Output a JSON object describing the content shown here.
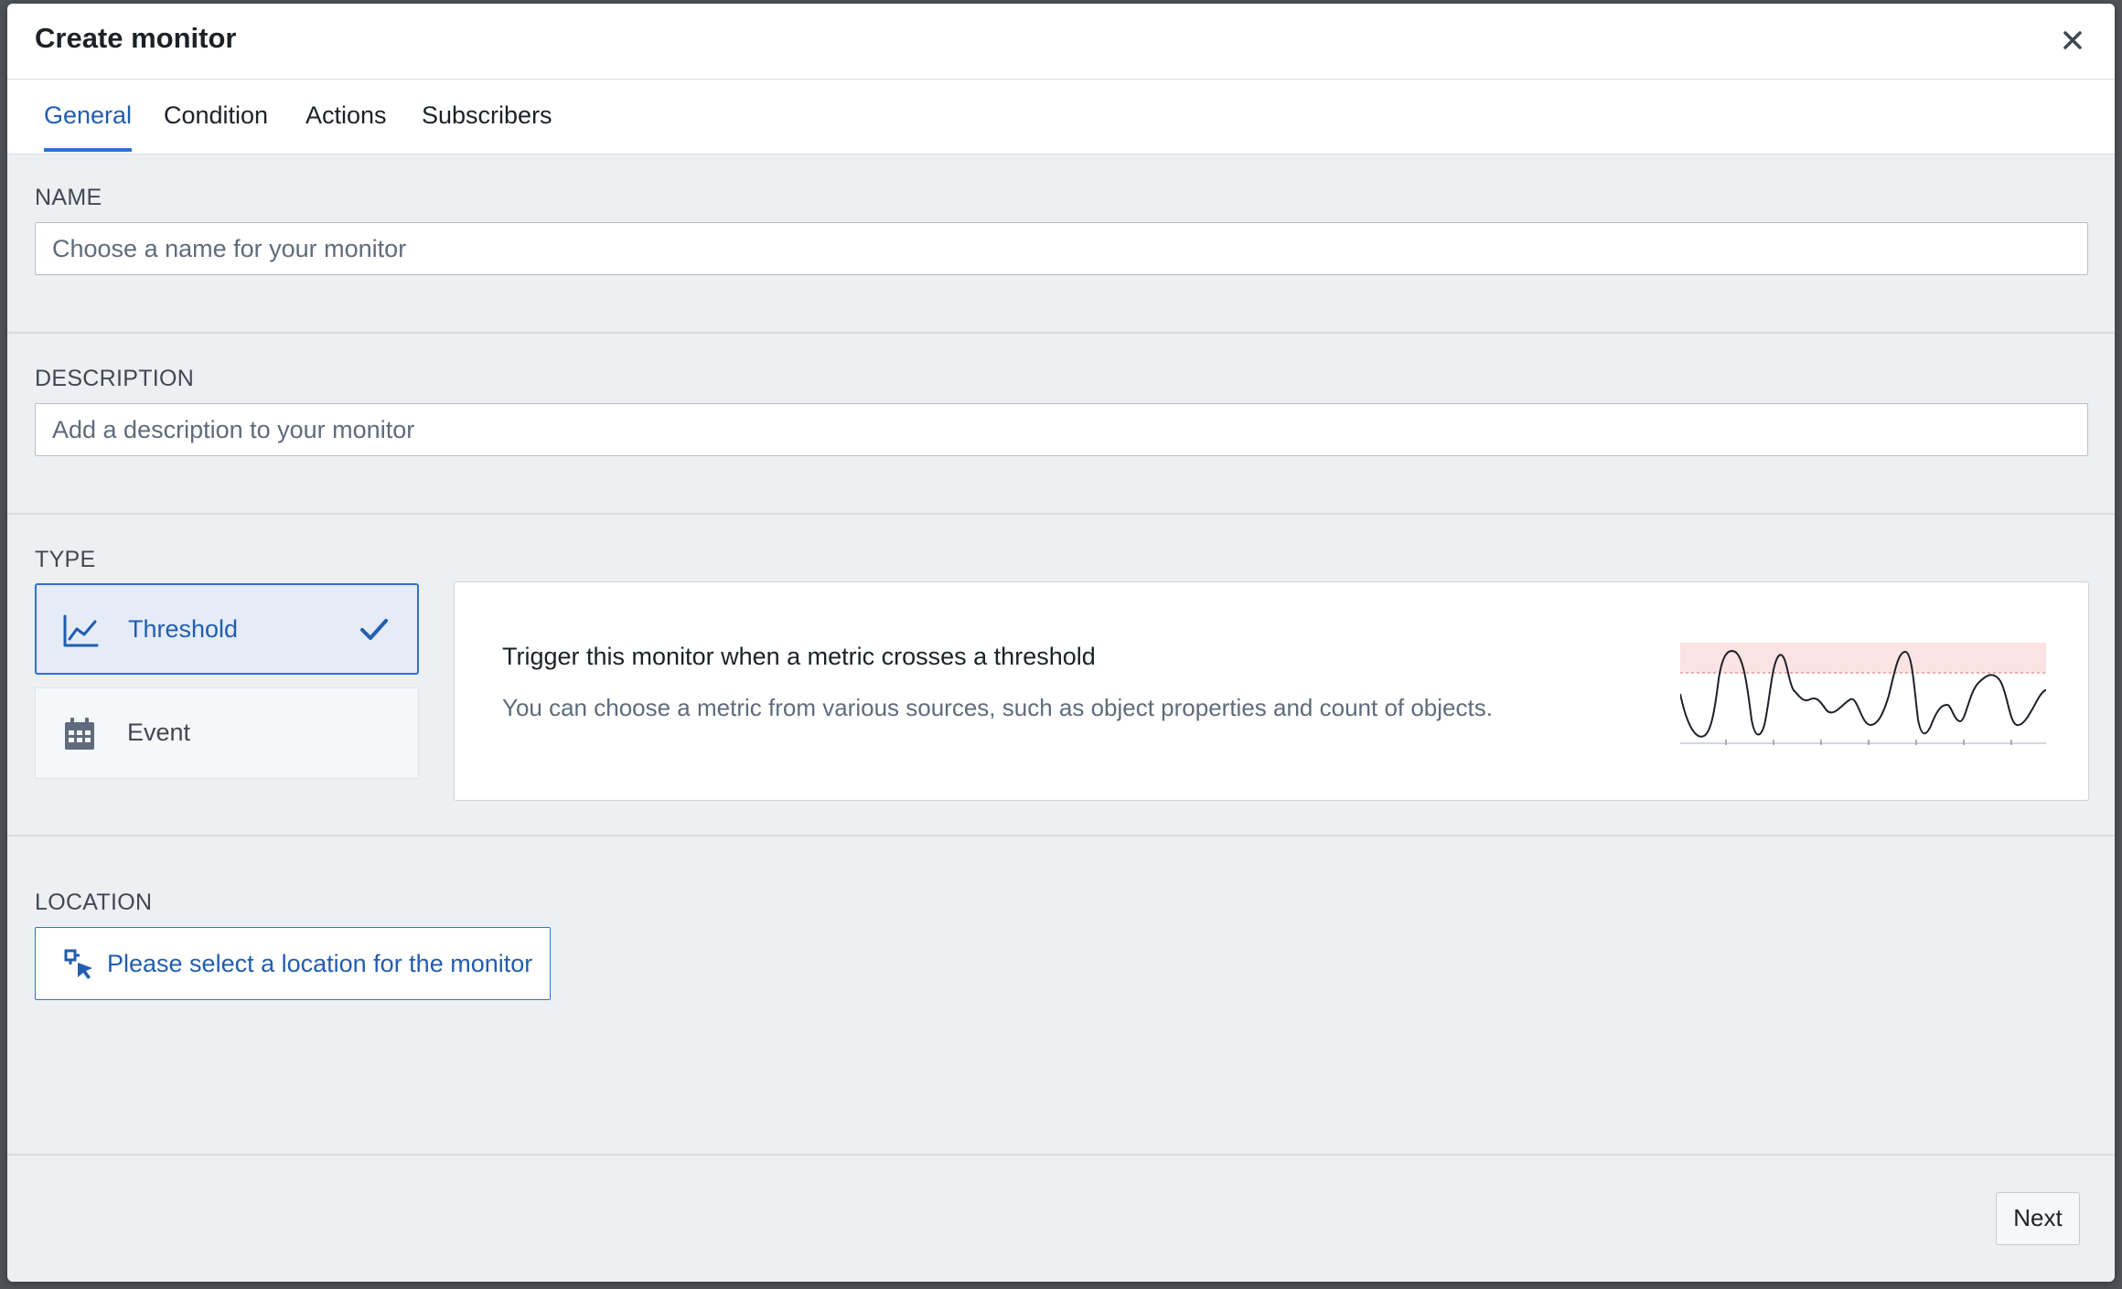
{
  "dialog": {
    "title": "Create monitor",
    "close_icon": "close-icon"
  },
  "tabs": [
    {
      "label": "General",
      "active": true
    },
    {
      "label": "Condition",
      "active": false
    },
    {
      "label": "Actions",
      "active": false
    },
    {
      "label": "Subscribers",
      "active": false
    }
  ],
  "name_section": {
    "label": "NAME",
    "value": "",
    "placeholder": "Choose a name for your monitor"
  },
  "description_section": {
    "label": "DESCRIPTION",
    "value": "",
    "placeholder": "Add a description to your monitor"
  },
  "type_section": {
    "label": "TYPE",
    "options": [
      {
        "label": "Threshold",
        "icon": "line-chart-icon",
        "selected": true
      },
      {
        "label": "Event",
        "icon": "calendar-icon",
        "selected": false
      }
    ],
    "selected_description": {
      "title": "Trigger this monitor when a metric crosses a threshold",
      "body": "You can choose a metric from various sources, such as object properties and count of objects."
    }
  },
  "location_section": {
    "label": "LOCATION",
    "button_label": "Please select a location for the monitor",
    "icon": "select-location-icon"
  },
  "footer": {
    "next_label": "Next"
  },
  "colors": {
    "accent": "#2d72d2",
    "accent_text": "#215db0",
    "threshold_band": "#fbe3e3"
  }
}
